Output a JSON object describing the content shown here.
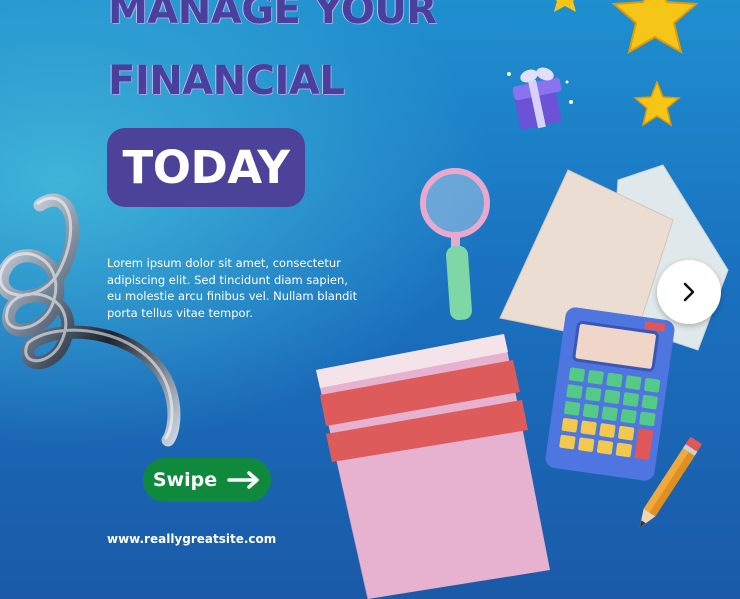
{
  "headline": {
    "line1": "MANAGE YOUR",
    "line2": "FINANCIAL",
    "highlight": "TODAY"
  },
  "body_text": "Lorem ipsum dolor sit amet, consectetur adipiscing elit. Sed tincidunt diam sapien, eu molestie arcu finibus vel. Nullam blandit porta tellus vitae tempor.",
  "swipe_button": {
    "label": "Swipe",
    "icon": "arrow-right-icon",
    "color": "#0f8a3c"
  },
  "website": "www.reallygreatsite.com",
  "next_button": {
    "icon": "chevron-right-icon"
  },
  "decorations": [
    "star-icon",
    "gift-icon",
    "magnifier-icon",
    "spiral-icon",
    "notebook-icon",
    "paper-icon",
    "calculator-icon",
    "pencil-icon"
  ],
  "colors": {
    "headline": "#4a3f9c",
    "highlight_box": "#4d429a",
    "background_top": "#1f8fcf",
    "background_bottom": "#1a5aa8"
  }
}
